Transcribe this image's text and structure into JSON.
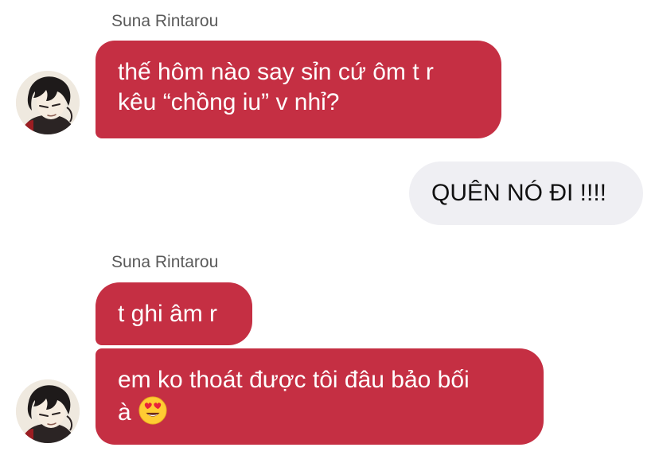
{
  "messages": [
    {
      "type": "incoming",
      "sender": "Suna Rintarou",
      "lines": [
        "thế hôm nào say sỉn cứ ôm t r",
        "kêu “chồng iu” v nhỉ?"
      ]
    },
    {
      "type": "outgoing",
      "lines": [
        "QUÊN NÓ ĐI !!!!"
      ]
    },
    {
      "type": "incoming",
      "sender": "Suna Rintarou",
      "lines": [
        "t ghi âm r"
      ]
    },
    {
      "type": "incoming",
      "lines": [
        "em ko thoát được tôi đâu bảo bối",
        "à"
      ],
      "emoji": "heart-eyes-emoji"
    }
  ],
  "avatar": {
    "icon": "anime-boy-avatar"
  },
  "colors": {
    "incoming_bubble": "#c52f43",
    "outgoing_bubble": "#efeff3",
    "sender_name": "#5a5a5a"
  }
}
